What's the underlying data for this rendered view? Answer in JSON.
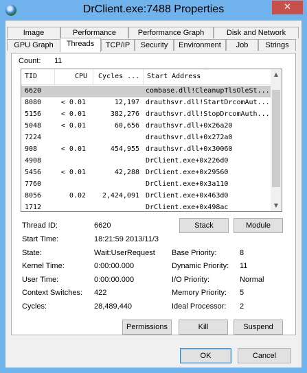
{
  "window": {
    "title": "DrClient.exe:7488 Properties",
    "close_label": "✕"
  },
  "tabs_row1": [
    "Image",
    "Performance",
    "Performance Graph",
    "Disk and Network"
  ],
  "tabs_row2": [
    "GPU Graph",
    "Threads",
    "TCP/IP",
    "Security",
    "Environment",
    "Job",
    "Strings"
  ],
  "threads": {
    "count_label": "Count:",
    "count_value": "11",
    "columns": [
      "TID",
      "CPU",
      "Cycles ...",
      "Start Address"
    ],
    "rows": [
      {
        "tid": "6620",
        "cpu": "",
        "cycles": "",
        "address": "combase.dll!CleanupTlsOleSt..."
      },
      {
        "tid": "8080",
        "cpu": "< 0.01",
        "cycles": "12,197",
        "address": "drauthsvr.dll!StartDrcomAut..."
      },
      {
        "tid": "5156",
        "cpu": "< 0.01",
        "cycles": "382,276",
        "address": "drauthsvr.dll!StopDrcomAuth..."
      },
      {
        "tid": "5048",
        "cpu": "< 0.01",
        "cycles": "60,656",
        "address": "drauthsvr.dll+0x26a20"
      },
      {
        "tid": "7224",
        "cpu": "",
        "cycles": "",
        "address": "drauthsvr.dll+0x272a0"
      },
      {
        "tid": "908",
        "cpu": "< 0.01",
        "cycles": "454,955",
        "address": "drauthsvr.dll+0x30060"
      },
      {
        "tid": "4908",
        "cpu": "",
        "cycles": "",
        "address": "DrClient.exe+0x226d0"
      },
      {
        "tid": "5456",
        "cpu": "< 0.01",
        "cycles": "42,288",
        "address": "DrClient.exe+0x29560"
      },
      {
        "tid": "7760",
        "cpu": "",
        "cycles": "",
        "address": "DrClient.exe+0x3a110"
      },
      {
        "tid": "8056",
        "cpu": "0.02",
        "cycles": "2,424,091",
        "address": "DrClient.exe+0x463d0"
      },
      {
        "tid": "1712",
        "cpu": "",
        "cycles": "",
        "address": "DrClient.exe+0x498ac"
      }
    ]
  },
  "details": {
    "thread_id_label": "Thread ID:",
    "thread_id": "6620",
    "start_time_label": "Start Time:",
    "start_time": "18:21:59  2013/11/3",
    "state_label": "State:",
    "state": "Wait:UserRequest",
    "kernel_time_label": "Kernel Time:",
    "kernel_time": "0:00:00.000",
    "user_time_label": "User Time:",
    "user_time": "0:00:00.000",
    "context_switches_label": "Context Switches:",
    "context_switches": "422",
    "cycles_label": "Cycles:",
    "cycles": "28,489,440",
    "base_priority_label": "Base Priority:",
    "base_priority": "8",
    "dynamic_priority_label": "Dynamic Priority:",
    "dynamic_priority": "11",
    "io_priority_label": "I/O Priority:",
    "io_priority": "Normal",
    "memory_priority_label": "Memory Priority:",
    "memory_priority": "5",
    "ideal_processor_label": "Ideal Processor:",
    "ideal_processor": "2"
  },
  "buttons": {
    "stack": "Stack",
    "module": "Module",
    "permissions": "Permissions",
    "kill": "Kill",
    "suspend": "Suspend",
    "ok": "OK",
    "cancel": "Cancel"
  }
}
